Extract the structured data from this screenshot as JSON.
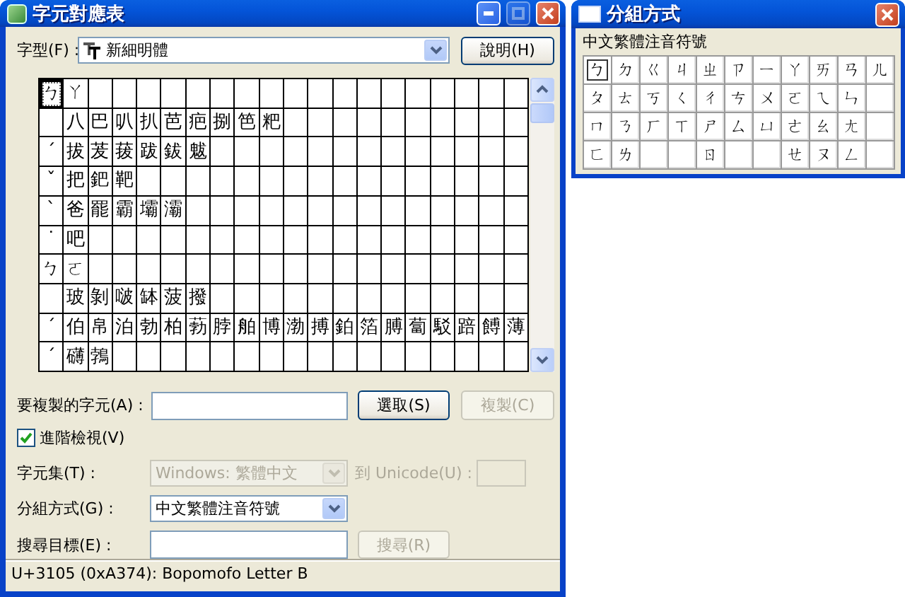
{
  "main_window": {
    "title": "字元對應表",
    "maximize_disabled": true,
    "font": {
      "label": "字型(F) :",
      "value": "新細明體"
    },
    "help_button": {
      "label": "說明(H)",
      "disabled": false
    },
    "grid": {
      "rows": [
        {
          "lead": "ㄅ",
          "lead_selected": true,
          "chars": [
            "ㄚ"
          ]
        },
        {
          "chars": [
            "八",
            "巴",
            "叭",
            "扒",
            "芭",
            "疤",
            "捌",
            "笆",
            "粑"
          ]
        },
        {
          "lead": "ˊ",
          "lead_selected": false,
          "chars": [
            "拔",
            "茇",
            "菝",
            "跋",
            "鈸",
            "魃"
          ]
        },
        {
          "lead": "ˇ",
          "lead_selected": false,
          "chars": [
            "把",
            "鈀",
            "靶"
          ]
        },
        {
          "lead": "ˋ",
          "lead_selected": false,
          "chars": [
            "爸",
            "罷",
            "霸",
            "壩",
            "灞"
          ]
        },
        {
          "lead": "˙",
          "lead_selected": false,
          "chars": [
            "吧"
          ]
        },
        {
          "lead": "ㄅ",
          "lead_selected": false,
          "chars": [
            "ㄛ"
          ]
        },
        {
          "chars": [
            "玻",
            "剝",
            "啵",
            "缽",
            "菠",
            "撥"
          ]
        },
        {
          "lead": "ˊ",
          "lead_selected": false,
          "chars": [
            "伯",
            "帛",
            "泊",
            "勃",
            "柏",
            "葧",
            "脖",
            "舶",
            "博",
            "渤",
            "搏",
            "鉑",
            "箔",
            "膊",
            "蔔",
            "駁",
            "踣",
            "餺",
            "薄"
          ]
        },
        {
          "lead": "ˊ",
          "lead_selected": false,
          "chars": [
            "礴",
            "鵓"
          ]
        }
      ]
    },
    "copy": {
      "label": "要複製的字元(A) :"
    },
    "select_button": {
      "label": "選取(S)",
      "disabled": false
    },
    "copy_button": {
      "label": "複製(C)",
      "disabled": true
    },
    "advanced_view": {
      "label": "進階檢視(V)",
      "checked": true
    },
    "charset": {
      "label": "字元集(T) :",
      "value": "Windows: 繁體中文",
      "disabled": true
    },
    "unicode": {
      "label": "到 Unicode(U) :",
      "disabled": true
    },
    "group_by": {
      "label": "分組方式(G) :",
      "value": "中文繁體注音符號",
      "disabled": false
    },
    "search": {
      "label": "搜尋目標(E) :"
    },
    "search_button": {
      "label": "搜尋(R)",
      "disabled": true
    },
    "status_bar": "U+3105 (0xA374): Bopomofo Letter B"
  },
  "group_window": {
    "title": "分組方式",
    "heading": "中文繁體注音符號",
    "rows": [
      [
        {
          "kind": "letter",
          "char": "ㄅ",
          "selected": true
        },
        {
          "kind": "letter",
          "char": "ㄉ",
          "selected": false
        },
        {
          "kind": "letter",
          "char": "ㄍ",
          "selected": false
        },
        {
          "kind": "letter",
          "char": "ㄐ",
          "selected": false
        },
        {
          "kind": "letter",
          "char": "ㄓ",
          "selected": false
        },
        {
          "kind": "letter",
          "char": "ㄗ",
          "selected": false
        },
        {
          "kind": "letter",
          "char": "ㄧ",
          "selected": false
        },
        {
          "kind": "letter",
          "char": "ㄚ",
          "selected": false
        },
        {
          "kind": "letter",
          "char": "ㄞ",
          "selected": false
        },
        {
          "kind": "letter",
          "char": "ㄢ",
          "selected": false
        },
        {
          "kind": "letter",
          "char": "ㄦ",
          "selected": false
        }
      ],
      [
        {
          "kind": "letter",
          "char": "ㄆ",
          "selected": false
        },
        {
          "kind": "letter",
          "char": "ㄊ",
          "selected": false
        },
        {
          "kind": "letter",
          "char": "ㄎ",
          "selected": false
        },
        {
          "kind": "letter",
          "char": "ㄑ",
          "selected": false
        },
        {
          "kind": "letter",
          "char": "ㄔ",
          "selected": false
        },
        {
          "kind": "letter",
          "char": "ㄘ",
          "selected": false
        },
        {
          "kind": "letter",
          "char": "ㄨ",
          "selected": false
        },
        {
          "kind": "letter",
          "char": "ㄛ",
          "selected": false
        },
        {
          "kind": "letter",
          "char": "ㄟ",
          "selected": false
        },
        {
          "kind": "letter",
          "char": "ㄣ",
          "selected": false
        },
        {
          "kind": "blank"
        }
      ],
      [
        {
          "kind": "letter",
          "char": "ㄇ",
          "selected": false
        },
        {
          "kind": "letter",
          "char": "ㄋ",
          "selected": false
        },
        {
          "kind": "letter",
          "char": "ㄏ",
          "selected": false
        },
        {
          "kind": "letter",
          "char": "ㄒ",
          "selected": false
        },
        {
          "kind": "letter",
          "char": "ㄕ",
          "selected": false
        },
        {
          "kind": "letter",
          "char": "ㄙ",
          "selected": false
        },
        {
          "kind": "letter",
          "char": "ㄩ",
          "selected": false
        },
        {
          "kind": "letter",
          "char": "ㄜ",
          "selected": false
        },
        {
          "kind": "letter",
          "char": "ㄠ",
          "selected": false
        },
        {
          "kind": "letter",
          "char": "ㄤ",
          "selected": false
        },
        {
          "kind": "blank"
        }
      ],
      [
        {
          "kind": "letter",
          "char": "ㄈ",
          "selected": false
        },
        {
          "kind": "letter",
          "char": "ㄌ",
          "selected": false
        },
        {
          "kind": "blank"
        },
        {
          "kind": "blank"
        },
        {
          "kind": "letter",
          "char": "ㄖ",
          "selected": false
        },
        {
          "kind": "blank"
        },
        {
          "kind": "blank"
        },
        {
          "kind": "letter",
          "char": "ㄝ",
          "selected": false
        },
        {
          "kind": "letter",
          "char": "ㄡ",
          "selected": false
        },
        {
          "kind": "letter",
          "char": "ㄥ",
          "selected": false
        },
        {
          "kind": "blank"
        }
      ]
    ]
  }
}
